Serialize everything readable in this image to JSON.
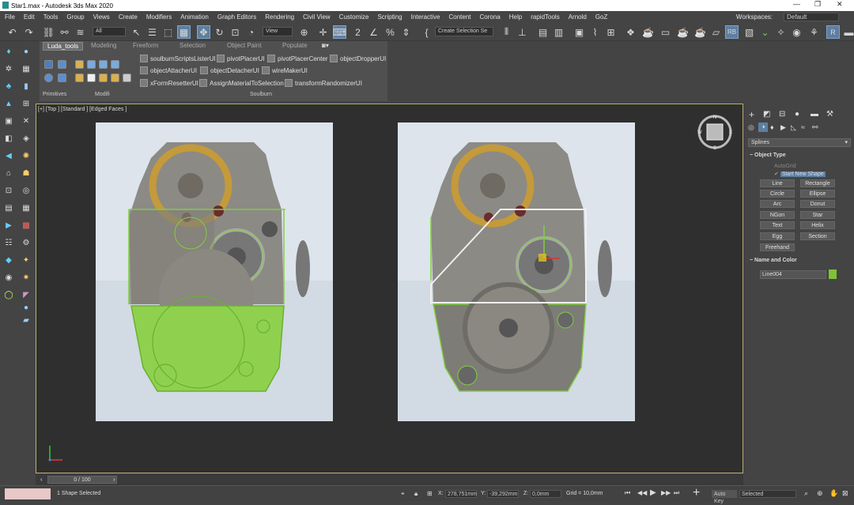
{
  "window": {
    "title": "Star1.max - Autodesk 3ds Max 2020"
  },
  "menu": [
    "File",
    "Edit",
    "Tools",
    "Group",
    "Views",
    "Create",
    "Modifiers",
    "Animation",
    "Graph Editors",
    "Rendering",
    "Civil View",
    "Customize",
    "Scripting",
    "Interactive",
    "Content",
    "Corona",
    "Help",
    "rapidTools",
    "Arnold",
    "GoZ"
  ],
  "workspaces": {
    "label": "Workspaces:",
    "value": "Default"
  },
  "toolbar": {
    "filter": "All",
    "refcoord": "View",
    "selection_set": "Create Selection Se"
  },
  "ribbon": {
    "tabs": [
      "Luda_tools",
      "Modeling",
      "Freeform",
      "Selection",
      "Object Paint",
      "Populate"
    ],
    "active_tab": "Luda_tools",
    "scripts": [
      "soulburnScriptsListerUI",
      "pivotPlacerUI",
      "pivotPlacerCenter",
      "objectDropperUI",
      "objectAttacherUI",
      "objectDetacherUI",
      "wireMakerUI",
      "xFormResetterUI",
      "AssignMaterialToSelection",
      "transformRandomizerUI"
    ],
    "groups": [
      "Primitives",
      "Modifi",
      "Soulburn"
    ]
  },
  "viewport": {
    "label": "[+] [Top ] [Standard ] [Edged Faces ]"
  },
  "command_panel": {
    "category": "Splines",
    "object_type_title": "Object Type",
    "autogrid": "AutoGrid",
    "start_new_shape": "Start New Shape",
    "buttons": [
      "Line",
      "Rectangle",
      "Circle",
      "Ellipse",
      "Arc",
      "Donut",
      "NGon",
      "Star",
      "Text",
      "Helix",
      "Egg",
      "Section",
      "Freehand"
    ],
    "name_color_title": "Name and Color",
    "object_name": "Line004",
    "object_color": "#7fc238"
  },
  "timeline": {
    "frame": "0 / 100"
  },
  "status": {
    "selection": "1 Shape Selected",
    "x_label": "X:",
    "x": "278,751mm",
    "y_label": "Y:",
    "y": "-39,292mm",
    "z_label": "Z:",
    "z": "0,0mm",
    "grid": "Grid = 10,0mm",
    "autokey": "Auto Key",
    "selected": "Selected"
  },
  "colors": {
    "accent": "#5d7fa1",
    "shape_fill": "#8fd14f",
    "spline": "#7fcf3f",
    "viewport_border": "#b8b070"
  }
}
